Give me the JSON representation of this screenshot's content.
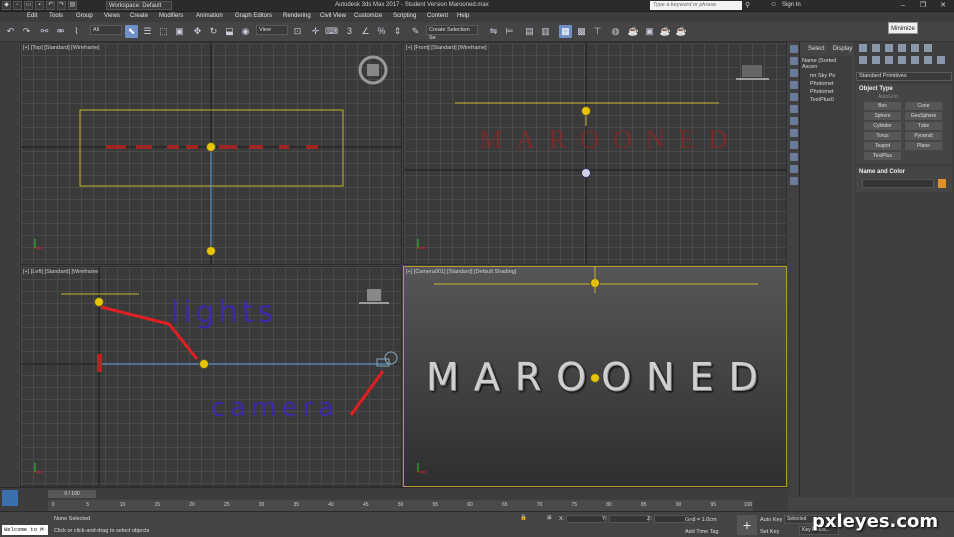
{
  "window": {
    "title": "Autodesk 3ds Max 2017 - Student Version    Marooned.max",
    "workspace": "Workspace: Default",
    "search_placeholder": "Type a keyword or phrase",
    "sign_in": "Sign In",
    "tooltip": "Minimize"
  },
  "menu": [
    "Edit",
    "Tools",
    "Group",
    "Views",
    "Create",
    "Modifiers",
    "Animation",
    "Graph Editors",
    "Rendering",
    "Civil View",
    "Customize",
    "Scripting",
    "Content",
    "Help"
  ],
  "toolbar": {
    "filter_value": "All",
    "refcoord_value": "View",
    "selection_set_placeholder": "Create Selection Se"
  },
  "viewports": {
    "top_label": "[+] [Top] [Standard] [Wireframe]",
    "front_label": "[+] [Front] [Standard] [Wireframe]",
    "left_label": "[+] [Left] [Standard] [Wireframe]",
    "camera_label": "[+] [Camera001] [Standard] [Default Shading]"
  },
  "scene_text": {
    "main": "MAROONED",
    "annotation_lights": "lights",
    "annotation_camera": "camera"
  },
  "scene_explorer": {
    "tab_select": "Select",
    "tab_display": "Display",
    "header": "Name (Sorted Ascen",
    "rows": [
      "mr Sky Po",
      "Photomet",
      "Photomet",
      "TextPlus0"
    ]
  },
  "command_panel": {
    "dropdown": "Standard Primitives",
    "object_type_header": "Object Type",
    "autogrid": "AutoGrid",
    "buttons": [
      "Box",
      "Cone",
      "Sphere",
      "GeoSphere",
      "Cylinder",
      "Tube",
      "Torus",
      "Pyramid",
      "Teapot",
      "Plane",
      "TextPlus"
    ],
    "name_color_header": "Name and Color",
    "object_color": "#e0902a"
  },
  "timeline": {
    "slider": "0 / 100",
    "ticks": [
      "0",
      "5",
      "10",
      "15",
      "20",
      "25",
      "30",
      "35",
      "40",
      "45",
      "50",
      "55",
      "60",
      "65",
      "70",
      "75",
      "80",
      "85",
      "90",
      "95",
      "100"
    ]
  },
  "status": {
    "maxscript": "Welcome to M",
    "selection": "None Selected",
    "prompt": "Click or click-and-drag to select objects",
    "x_label": "X:",
    "y_label": "Y:",
    "z_label": "Z:",
    "grid": "Grid = 1.0cm",
    "add_time_tag": "Add Time Tag",
    "auto_key": "Auto Key",
    "set_key": "Set Key",
    "selected": "Selected",
    "key_filters": "Key Filters..."
  },
  "watermark": "pxleyes.com"
}
